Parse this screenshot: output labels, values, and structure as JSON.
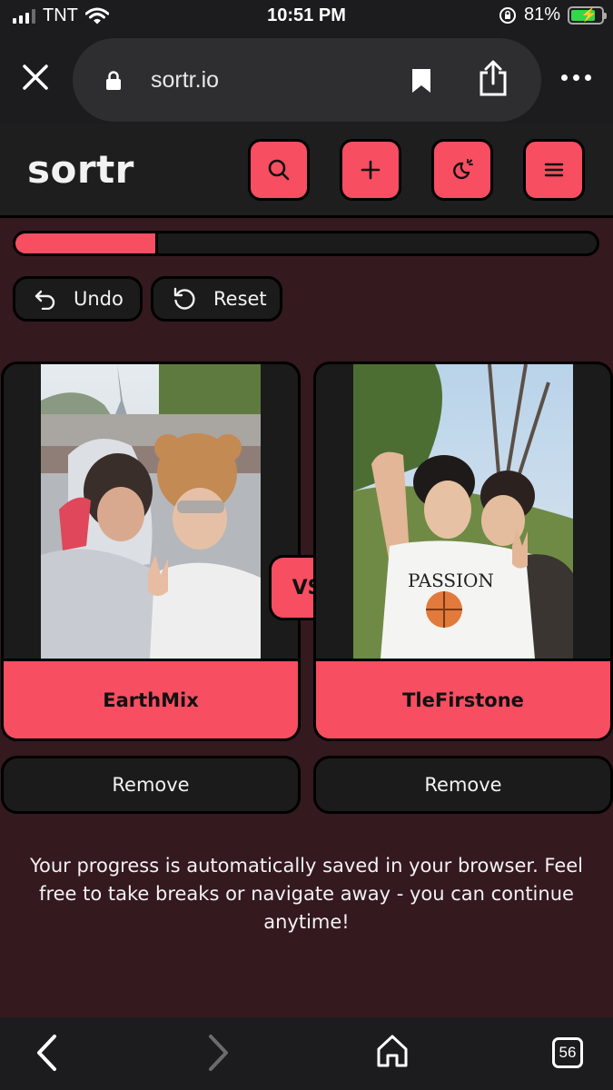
{
  "status_bar": {
    "carrier": "TNT",
    "time": "10:51 PM",
    "battery": "81%",
    "battery_level": 0.81,
    "icons": [
      "signal-icon",
      "wifi-icon",
      "rotation-lock-icon",
      "battery-charging-icon"
    ]
  },
  "browser": {
    "url": "sortr.io",
    "icons": [
      "close-icon",
      "lock-icon",
      "bookmark-icon",
      "share-icon",
      "more-icon"
    ]
  },
  "app": {
    "logo": "sortr",
    "header_icons": [
      "search-icon",
      "plus-icon",
      "theme-icon",
      "menu-icon"
    ],
    "accent_color": "#f74e61",
    "background_color": "#34191e"
  },
  "progress": {
    "fraction": 0.245
  },
  "actions": {
    "undo": "Undo",
    "reset": "Reset"
  },
  "matchup": {
    "left": {
      "name": "EarthMix",
      "remove": "Remove"
    },
    "vs": "VS",
    "right": {
      "name": "TleFirstone",
      "remove": "Remove"
    }
  },
  "note": "Your progress is automatically saved in your browser. Feel free to take breaks or navigate away - you can continue anytime!",
  "bottom_bar": {
    "tab_count": "56",
    "icons": [
      "back-icon",
      "forward-icon",
      "home-icon",
      "tabs-icon"
    ]
  }
}
